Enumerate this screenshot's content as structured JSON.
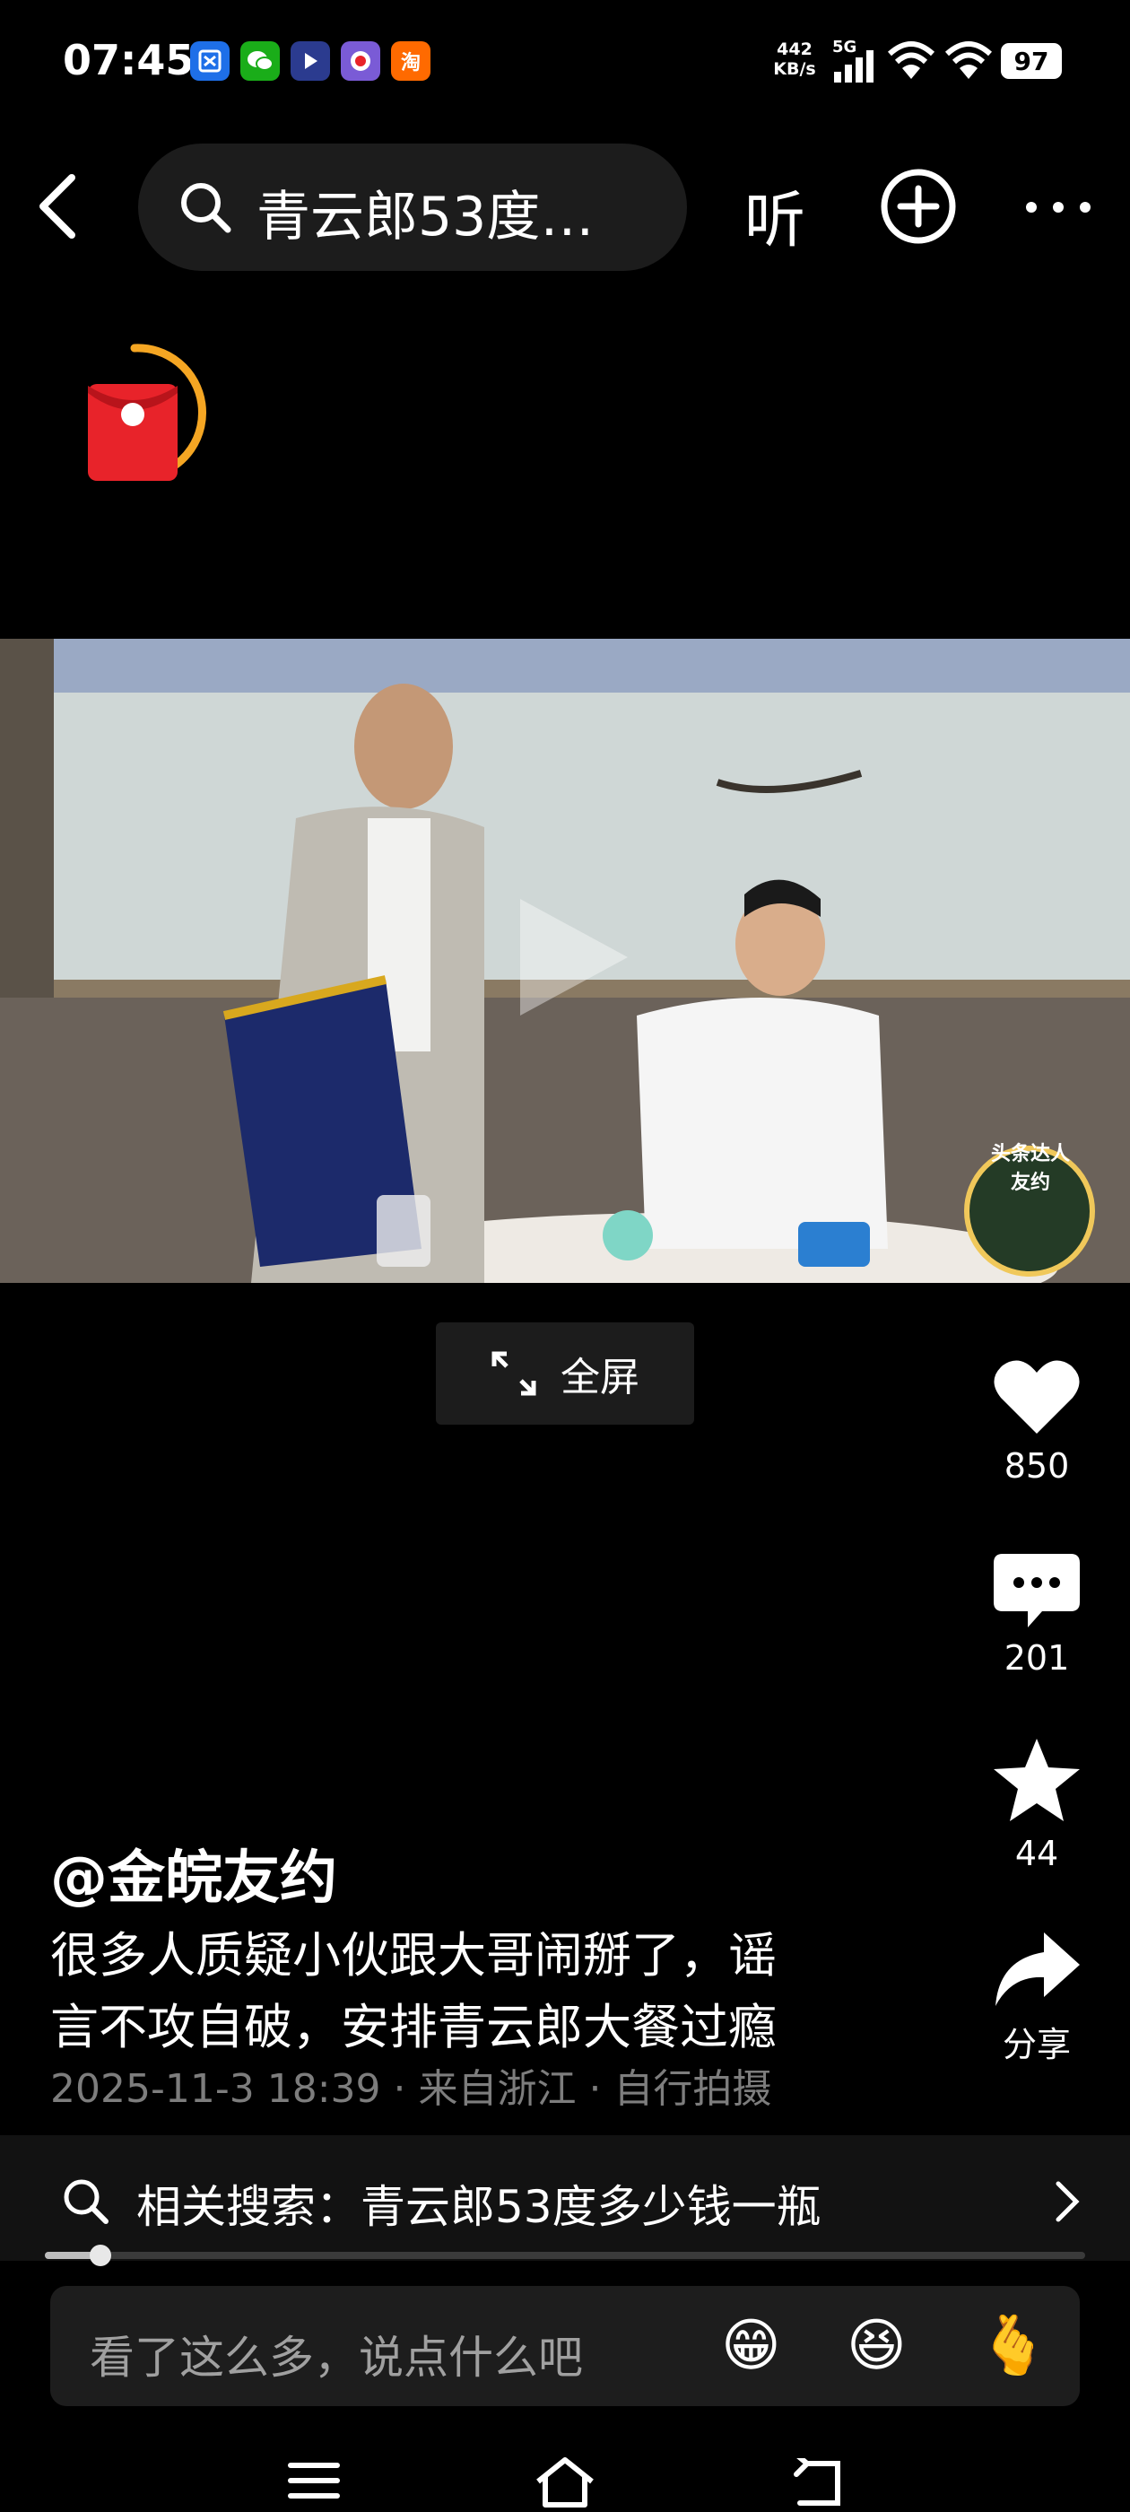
{
  "status_bar": {
    "time": "07:45",
    "app_icons": [
      {
        "name": "app-icon-1",
        "glyph": "☒",
        "color": "#1e6fe8"
      },
      {
        "name": "wechat-icon",
        "glyph": "💬",
        "color": "#1aad19"
      },
      {
        "name": "player-app-icon",
        "glyph": "▶",
        "color": "#2b3b8f"
      },
      {
        "name": "game-app-icon",
        "glyph": "●",
        "color": "#7a5bd6"
      },
      {
        "name": "taobao-icon",
        "glyph": "淘",
        "color": "#ff6a00"
      }
    ],
    "net_speed_value": "442",
    "net_speed_unit": "KB/s",
    "network_label": "5G",
    "battery": "97"
  },
  "top_bar": {
    "search_text": "青云郎53度…",
    "listen_label": "听"
  },
  "video": {
    "fullscreen_label": "全屏",
    "watermark_text": "头条达人 友约"
  },
  "actions": {
    "likes": "850",
    "comments": "201",
    "favorites": "44",
    "share_label": "分享"
  },
  "post": {
    "author": "@金皖友约",
    "caption_line1": "很多人质疑小伙跟大哥闹掰了，谣",
    "caption_line2": "言不攻自破，安排青云郎大餐过瘾",
    "meta": "2025-11-3 18:39 · 来自浙江 · 自行拍摄"
  },
  "related_search": {
    "text": "相关搜索：青云郎53度多少钱一瓶"
  },
  "comment_bar": {
    "placeholder": "看了这么多，说点什么吧",
    "emojis": [
      "😁",
      "😆",
      "🫰"
    ]
  },
  "colors": {
    "background": "#000000",
    "accent_red": "#e8232a",
    "ring_orange": "#f5a623"
  }
}
